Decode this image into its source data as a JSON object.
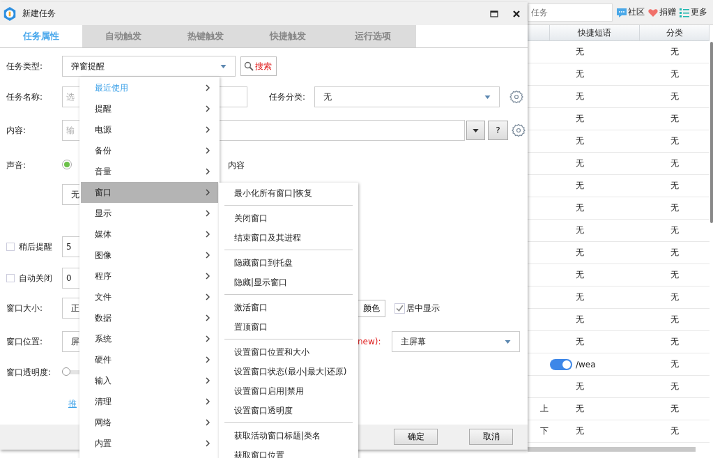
{
  "app": {
    "search": {
      "placeholder": "任务"
    },
    "toolbar": [
      {
        "label": "社区",
        "kind": "chat"
      },
      {
        "label": "捐赠",
        "kind": "heart"
      },
      {
        "label": "更多",
        "kind": "list"
      }
    ],
    "table": {
      "columns": [
        "快捷短语",
        "分类"
      ],
      "rows": [
        {
          "kind": "plain",
          "shortcut": "无",
          "category": "无"
        },
        {
          "kind": "plain",
          "shortcut": "无",
          "category": "无"
        },
        {
          "kind": "plain",
          "shortcut": "无",
          "category": "无"
        },
        {
          "kind": "plain",
          "shortcut": "无",
          "category": "无"
        },
        {
          "kind": "plain",
          "shortcut": "无",
          "category": "无"
        },
        {
          "kind": "plain",
          "shortcut": "无",
          "category": "无"
        },
        {
          "kind": "plain",
          "shortcut": "无",
          "category": "无"
        },
        {
          "kind": "plain",
          "shortcut": "无",
          "category": "无"
        },
        {
          "kind": "plain",
          "shortcut": "无",
          "category": "无"
        },
        {
          "kind": "plain",
          "shortcut": "无",
          "category": "无"
        },
        {
          "kind": "plain",
          "shortcut": "无",
          "category": "无"
        },
        {
          "kind": "plain",
          "shortcut": "无",
          "category": "无"
        },
        {
          "kind": "plain",
          "shortcut": "无",
          "category": "无"
        },
        {
          "kind": "plain",
          "shortcut": "无",
          "category": "无"
        },
        {
          "kind": "toggle",
          "on": true,
          "shortcut": "/wea",
          "category": "无"
        },
        {
          "kind": "plain",
          "shortcut": "无",
          "category": "无"
        },
        {
          "kind": "plain",
          "name": "上",
          "shortcut": "无",
          "category": "无"
        },
        {
          "kind": "plain",
          "name": "下",
          "shortcut": "无",
          "category": "无"
        }
      ]
    }
  },
  "dialog": {
    "title": "新建任务",
    "tabs": [
      {
        "label": "任务属性",
        "selected": true
      },
      {
        "label": "自动触发",
        "selected": false
      },
      {
        "label": "热键触发",
        "selected": false
      },
      {
        "label": "快捷触发",
        "selected": false
      },
      {
        "label": "运行选项",
        "selected": false
      }
    ],
    "form": {
      "task_type": {
        "label": "任务类型:",
        "value": "弹窗提醒",
        "search_button": "搜索"
      },
      "task_name": {
        "label": "任务名称:",
        "placeholder": "选"
      },
      "task_category": {
        "label": "任务分类:",
        "value": "无"
      },
      "content": {
        "label": "内容:",
        "placeholder": "输",
        "help_button": "?"
      },
      "sound": {
        "label": "声音:",
        "options": [
          {
            "selected": true
          }
        ],
        "extra_text": "内容",
        "value": "无"
      },
      "snooze": {
        "label": "稍后提醒",
        "checked": false,
        "value": "5"
      },
      "auto_close": {
        "label": "自动关闭",
        "checked": false,
        "value": "0"
      },
      "window_size": {
        "label": "窗口大小:",
        "value": "正",
        "color_button": "颜色",
        "center": {
          "label": "居中显示",
          "checked": true
        }
      },
      "window_position": {
        "label": "窗口位置:",
        "value": "屏",
        "monitor_label": "new):",
        "monitor_value": "主屏幕"
      },
      "opacity": {
        "label": "窗口透明度:",
        "level": 0
      },
      "link": "推"
    },
    "buttons": [
      "确定",
      "取消"
    ]
  },
  "menu": {
    "items": [
      {
        "label": "最近使用",
        "kind": "recent",
        "selected": false
      },
      {
        "label": "提醒",
        "kind": "category",
        "selected": false
      },
      {
        "label": "电源",
        "kind": "category",
        "selected": false
      },
      {
        "label": "备份",
        "kind": "category",
        "selected": false
      },
      {
        "label": "音量",
        "kind": "category",
        "selected": false
      },
      {
        "label": "窗口",
        "kind": "category",
        "selected": true
      },
      {
        "label": "显示",
        "kind": "category",
        "selected": false
      },
      {
        "label": "媒体",
        "kind": "category",
        "selected": false
      },
      {
        "label": "图像",
        "kind": "category",
        "selected": false
      },
      {
        "label": "程序",
        "kind": "category",
        "selected": false
      },
      {
        "label": "文件",
        "kind": "category",
        "selected": false
      },
      {
        "label": "数据",
        "kind": "category",
        "selected": false
      },
      {
        "label": "系统",
        "kind": "category",
        "selected": false
      },
      {
        "label": "硬件",
        "kind": "category",
        "selected": false
      },
      {
        "label": "输入",
        "kind": "category",
        "selected": false
      },
      {
        "label": "清理",
        "kind": "category",
        "selected": false
      },
      {
        "label": "网络",
        "kind": "category",
        "selected": false
      },
      {
        "label": "内置",
        "kind": "category",
        "selected": false
      }
    ]
  },
  "submenu": {
    "groups": [
      [
        "最小化所有窗口|恢复"
      ],
      [
        "关闭窗口",
        "结束窗口及其进程"
      ],
      [
        "隐藏窗口到托盘",
        "隐藏|显示窗口"
      ],
      [
        "激活窗口",
        "置顶窗口"
      ],
      [
        "设置窗口位置和大小",
        "设置窗口状态(最小|最大|还原)",
        "设置窗口启用|禁用",
        "设置窗口透明度"
      ],
      [
        "获取活动窗口标题|类名",
        "获取窗口位置"
      ]
    ]
  }
}
